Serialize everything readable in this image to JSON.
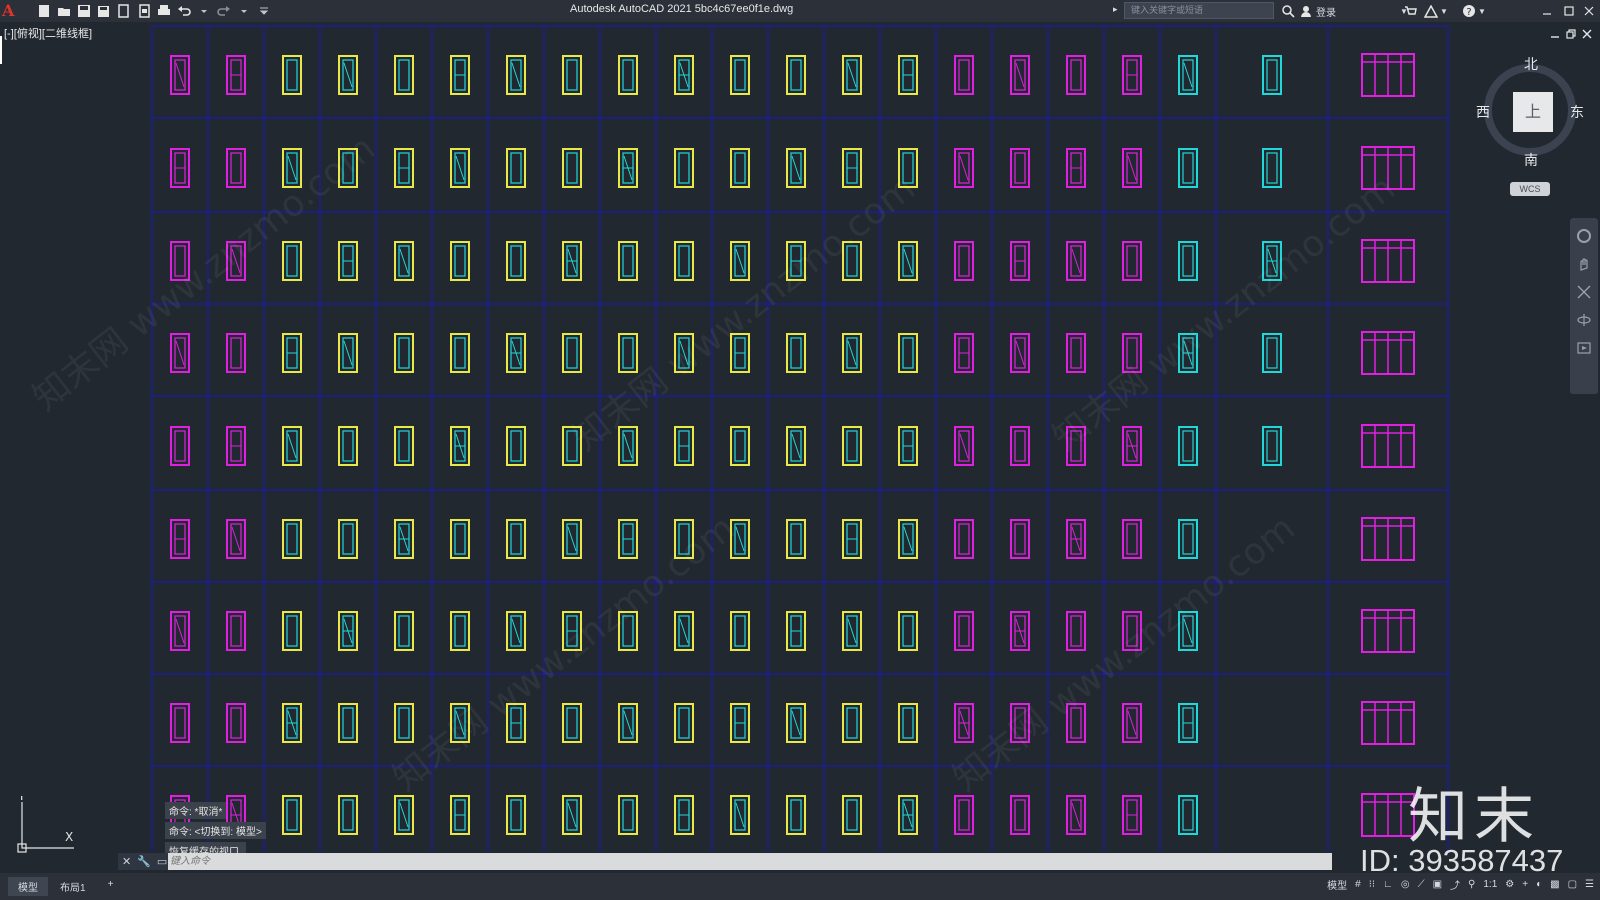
{
  "titlebar": {
    "app_logo": "A",
    "window_title": "Autodesk AutoCAD 2021    5bc4c67ee0f1e.dwg",
    "search_placeholder": "键入关键字或短语",
    "login_label": "登录"
  },
  "viewport": {
    "view_label": "[-][俯视][二维线框]"
  },
  "viewcube": {
    "north": "北",
    "south": "南",
    "east": "东",
    "west": "西",
    "face": "上",
    "wcs": "WCS"
  },
  "command": {
    "history": [
      "命令: *取消*",
      "命令:  <切换到: 模型>",
      "恢复缓存的视口."
    ],
    "placeholder": "键入命令"
  },
  "status": {
    "tabs": [
      "模型",
      "布局1"
    ],
    "add_tab": "+",
    "model_label": "模型",
    "scale": "1:1"
  },
  "ucs": {
    "y": "Y",
    "x": "X"
  },
  "watermark": {
    "logo": "知末",
    "id": "ID: 393587437",
    "site": "知末网 www.znzmo.com"
  },
  "colors": {
    "background": "#212830",
    "grid": "#1818c8",
    "magenta": "#e020e0",
    "yellow": "#e8e848",
    "cyan": "#20d8d8",
    "white": "#f0f0f0"
  }
}
